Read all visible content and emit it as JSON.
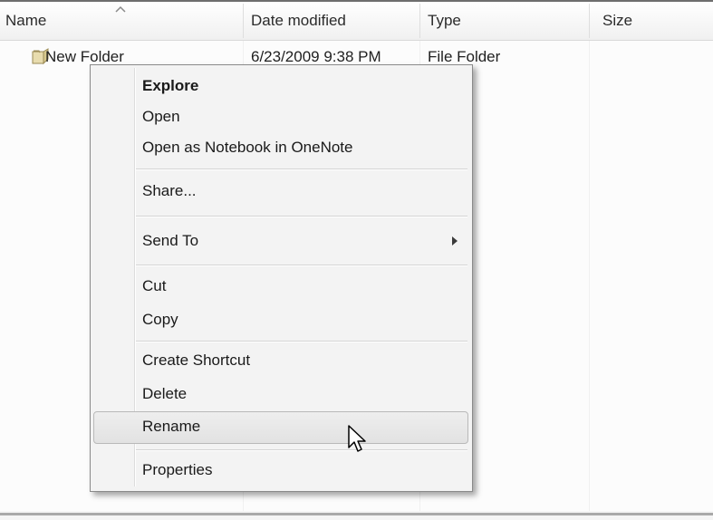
{
  "columns": {
    "name": "Name",
    "date_modified": "Date modified",
    "type": "Type",
    "size": "Size"
  },
  "file": {
    "name": "New Folder",
    "date_modified": "6/23/2009 9:38 PM",
    "type": "File Folder",
    "size": ""
  },
  "context_menu": {
    "items": [
      {
        "label": "Explore"
      },
      {
        "label": "Open"
      },
      {
        "label": "Open as Notebook in OneNote"
      },
      {
        "label": "Share..."
      },
      {
        "label": "Send To"
      },
      {
        "label": "Cut"
      },
      {
        "label": "Copy"
      },
      {
        "label": "Create Shortcut"
      },
      {
        "label": "Delete"
      },
      {
        "label": "Rename"
      },
      {
        "label": "Properties"
      }
    ],
    "highlighted": "Rename"
  }
}
